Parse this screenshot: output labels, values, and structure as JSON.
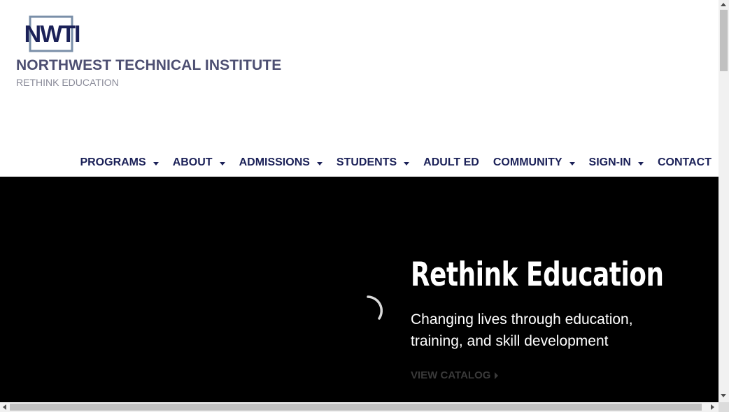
{
  "header": {
    "logo_text": "NWTI",
    "site_title": "NORTHWEST TECHNICAL INSTITUTE",
    "tagline": "RETHINK EDUCATION"
  },
  "nav": {
    "items": [
      {
        "label": "PROGRAMS",
        "has_submenu": true
      },
      {
        "label": "ABOUT",
        "has_submenu": true
      },
      {
        "label": "ADMISSIONS",
        "has_submenu": true
      },
      {
        "label": "STUDENTS",
        "has_submenu": true
      },
      {
        "label": "ADULT ED",
        "has_submenu": false
      },
      {
        "label": "COMMUNITY",
        "has_submenu": true
      },
      {
        "label": "SIGN-IN",
        "has_submenu": true
      },
      {
        "label": "CONTACT",
        "has_submenu": false
      }
    ]
  },
  "hero": {
    "title": "Rethink Education",
    "subtitle": "Changing lives through education, training, and skill development",
    "cta_label": "VIEW CATALOG"
  },
  "colors": {
    "brand_navy": "#1b2158",
    "title_gray": "#4d4f72",
    "logo_frame": "#7a8fa8",
    "hero_bg": "#000000"
  },
  "icons": {
    "caret": "caret-down-icon",
    "cta": "caret-right-icon",
    "loader": "loading-spinner-icon"
  }
}
